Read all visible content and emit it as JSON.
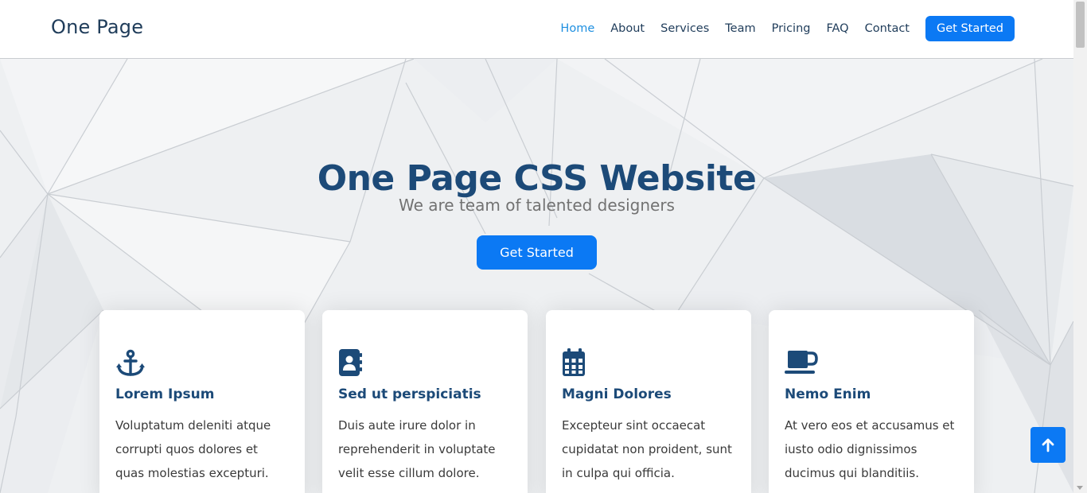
{
  "header": {
    "logo": "One Page",
    "nav": [
      {
        "label": "Home",
        "active": true
      },
      {
        "label": "About"
      },
      {
        "label": "Services"
      },
      {
        "label": "Team"
      },
      {
        "label": "Pricing"
      },
      {
        "label": "FAQ"
      },
      {
        "label": "Contact"
      }
    ],
    "cta_label": "Get Started"
  },
  "hero": {
    "title": "One Page CSS Website",
    "subtitle": "We are team of talented designers",
    "button_label": "Get Started"
  },
  "cards": [
    {
      "icon": "anchor-icon",
      "title": "Lorem Ipsum",
      "text": "Voluptatum deleniti atque corrupti quos dolores et quas molestias excepturi."
    },
    {
      "icon": "address-book-icon",
      "title": "Sed ut perspiciatis",
      "text": "Duis aute irure dolor in reprehenderit in voluptate velit esse cillum dolore."
    },
    {
      "icon": "calendar-icon",
      "title": "Magni Dolores",
      "text": "Excepteur sint occaecat cupidatat non proident, sunt in culpa qui officia."
    },
    {
      "icon": "coffee-cup-icon",
      "title": "Nemo Enim",
      "text": "At vero eos et accusamus et iusto odio dignissimos ducimus qui blanditiis."
    }
  ],
  "colors": {
    "primary": "#0b79f4",
    "heading": "#1c4a78",
    "nav_active": "#1e8fe0"
  },
  "back_to_top_icon": "arrow-up-icon"
}
